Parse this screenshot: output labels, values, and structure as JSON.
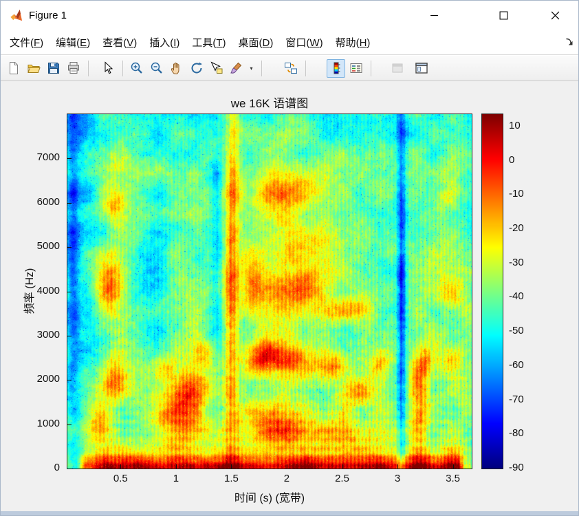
{
  "window": {
    "title": "Figure 1"
  },
  "menubar": {
    "items": [
      {
        "name": "file",
        "pre": "文件(",
        "key": "F",
        "post": ")"
      },
      {
        "name": "edit",
        "pre": "编辑(",
        "key": "E",
        "post": ")"
      },
      {
        "name": "view",
        "pre": "查看(",
        "key": "V",
        "post": ")"
      },
      {
        "name": "insert",
        "pre": "插入(",
        "key": "I",
        "post": ")"
      },
      {
        "name": "tools",
        "pre": "工具(",
        "key": "T",
        "post": ")"
      },
      {
        "name": "desktop",
        "pre": "桌面(",
        "key": "D",
        "post": ")"
      },
      {
        "name": "window",
        "pre": "窗口(",
        "key": "W",
        "post": ")"
      },
      {
        "name": "help",
        "pre": "帮助(",
        "key": "H",
        "post": ")"
      }
    ]
  },
  "toolbar": {
    "buttons": [
      {
        "type": "button",
        "name": "new-figure",
        "icon": "new-doc-icon"
      },
      {
        "type": "button",
        "name": "open-file",
        "icon": "open-folder-icon"
      },
      {
        "type": "button",
        "name": "save-figure",
        "icon": "save-icon"
      },
      {
        "type": "button",
        "name": "print-figure",
        "icon": "print-icon"
      },
      {
        "type": "separator"
      },
      {
        "type": "button",
        "name": "edit-plot",
        "icon": "cursor-icon"
      },
      {
        "type": "separator"
      },
      {
        "type": "button",
        "name": "zoom-in",
        "icon": "zoom-in-icon"
      },
      {
        "type": "button",
        "name": "zoom-out",
        "icon": "zoom-out-icon"
      },
      {
        "type": "button",
        "name": "pan",
        "icon": "hand-icon"
      },
      {
        "type": "button",
        "name": "rotate-3d",
        "icon": "rotate-icon"
      },
      {
        "type": "button",
        "name": "data-cursor",
        "icon": "data-cursor-icon"
      },
      {
        "type": "button",
        "name": "brush-data",
        "icon": "brush-icon",
        "dropdown": true
      },
      {
        "type": "separator"
      },
      {
        "type": "button",
        "name": "link-plot",
        "icon": "link-plot-icon"
      },
      {
        "type": "separator"
      },
      {
        "type": "button",
        "name": "insert-colorbar",
        "icon": "colorbar-icon",
        "active": true
      },
      {
        "type": "button",
        "name": "insert-legend",
        "icon": "legend-icon"
      },
      {
        "type": "separator"
      },
      {
        "type": "button",
        "name": "hide-plot-tools",
        "icon": "hide-plot-tools-icon",
        "disabled": true
      },
      {
        "type": "button",
        "name": "show-plot-tools",
        "icon": "show-plot-tools-icon"
      }
    ],
    "dropdown_glyph": "▾"
  },
  "chart_data": {
    "type": "heatmap",
    "subtype": "spectrogram",
    "title": "we  16K  语谱图",
    "xlabel": "时间 (s) (宽带)",
    "ylabel": "频率 (Hz)",
    "x_range": [
      0.02,
      3.67
    ],
    "y_range": [
      0,
      8000
    ],
    "color_range_db": [
      -90,
      13.6
    ],
    "colormap": "jet",
    "x_ticks": [
      0.5,
      1,
      1.5,
      2,
      2.5,
      3,
      3.5
    ],
    "x_tick_labels": [
      "0.5",
      "1",
      "1.5",
      "2",
      "2.5",
      "3",
      "3.5"
    ],
    "y_ticks": [
      0,
      1000,
      2000,
      3000,
      4000,
      5000,
      6000,
      7000
    ],
    "y_tick_labels": [
      "0",
      "1000",
      "2000",
      "3000",
      "4000",
      "5000",
      "6000",
      "7000"
    ],
    "colorbar_ticks": [
      10,
      0,
      -10,
      -20,
      -30,
      -40,
      -50,
      -60,
      -70,
      -80,
      -90
    ],
    "colorbar_tick_labels": [
      "10",
      "0",
      "-10",
      "-20",
      "-30",
      "-40",
      "-50",
      "-60",
      "-70",
      "-80",
      "-90"
    ],
    "synthesis": {
      "seed": 7,
      "base_db": -44,
      "noise": {
        "coarse_amp": 9,
        "fine_amp": 5,
        "speckle_amp": 3.5
      },
      "voiced_segments": [
        [
          0.45,
          0.22
        ],
        [
          1.05,
          0.3
        ],
        [
          1.5,
          0.1
        ],
        [
          2.05,
          0.45
        ],
        [
          2.7,
          0.35
        ],
        [
          3.3,
          0.25
        ],
        [
          3.55,
          0.18
        ]
      ],
      "voiced_boost_db": 10,
      "low_band": {
        "amp_db": 42,
        "f_scale": 300,
        "t_on": 0.1,
        "t_off": 3.62
      },
      "stripes": {
        "freq_hz": 30,
        "amp_db": 5
      },
      "harmonics": {
        "period_hz": 200,
        "amp_db": 3.5
      },
      "high_rolloff": {
        "start_hz": 6800,
        "amp_db": 6
      },
      "blobs": [
        [
          0.45,
          2100,
          0.13,
          450,
          30
        ],
        [
          0.42,
          4100,
          0.14,
          650,
          26
        ],
        [
          0.45,
          5900,
          0.1,
          400,
          18
        ],
        [
          0.28,
          1000,
          0.1,
          500,
          20
        ],
        [
          0.5,
          6900,
          0.12,
          350,
          10
        ],
        [
          1.0,
          1100,
          0.22,
          600,
          30
        ],
        [
          1.15,
          1800,
          0.15,
          500,
          26
        ],
        [
          1.25,
          2600,
          0.1,
          300,
          20
        ],
        [
          0.9,
          2300,
          0.1,
          300,
          14
        ],
        [
          1.5,
          3500,
          0.06,
          3200,
          26
        ],
        [
          1.52,
          7000,
          0.06,
          1800,
          14
        ],
        [
          1.75,
          2500,
          0.15,
          400,
          26
        ],
        [
          1.85,
          1000,
          0.3,
          500,
          22
        ],
        [
          1.7,
          4300,
          0.1,
          600,
          20
        ],
        [
          1.95,
          5500,
          0.38,
          2600,
          10
        ],
        [
          2.0,
          2450,
          0.3,
          380,
          28
        ],
        [
          2.05,
          4050,
          0.3,
          500,
          26
        ],
        [
          2.0,
          6250,
          0.28,
          380,
          18
        ],
        [
          2.25,
          800,
          0.7,
          300,
          16
        ],
        [
          2.3,
          5000,
          0.25,
          400,
          12
        ],
        [
          2.45,
          2300,
          0.12,
          320,
          24
        ],
        [
          2.65,
          1700,
          0.13,
          320,
          24
        ],
        [
          2.85,
          2350,
          0.1,
          320,
          24
        ],
        [
          2.6,
          3600,
          0.28,
          280,
          16
        ],
        [
          3.2,
          1300,
          0.09,
          1300,
          24
        ],
        [
          3.25,
          2450,
          0.08,
          400,
          18
        ],
        [
          3.5,
          2400,
          0.13,
          380,
          22
        ],
        [
          3.5,
          3850,
          0.13,
          420,
          16
        ],
        [
          3.45,
          6100,
          0.12,
          350,
          14
        ],
        [
          3.5,
          6800,
          0.12,
          600,
          10
        ],
        [
          3.04,
          4000,
          0.04,
          4800,
          -30
        ],
        [
          0.07,
          5000,
          0.06,
          4500,
          -22
        ],
        [
          1.37,
          5500,
          0.06,
          2600,
          -12
        ],
        [
          0.75,
          4200,
          0.18,
          1800,
          -12
        ],
        [
          0.2,
          6500,
          0.12,
          1500,
          -10
        ],
        [
          0.2,
          3000,
          0.1,
          1500,
          -8
        ]
      ]
    }
  }
}
